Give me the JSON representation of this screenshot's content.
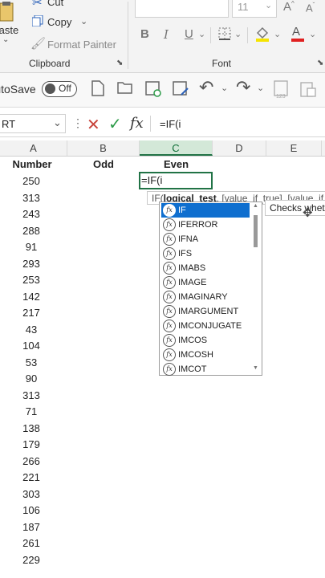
{
  "ribbon": {
    "cut_label": "Cut",
    "copy_label": "Copy",
    "paste_label": "Paste",
    "format_painter_label": "Format Painter",
    "clipboard_group": "Clipboard",
    "font_group": "Font",
    "font_size": "11",
    "bold": "B",
    "italic": "I",
    "underline": "U",
    "font_color_letter": "A"
  },
  "qat": {
    "autosave_label": "AutoSave",
    "toggle_label": "Off"
  },
  "formula_bar": {
    "name_box": "RT",
    "fx_label": "fx",
    "formula": "=IF(i"
  },
  "columns": [
    "A",
    "B",
    "C",
    "D",
    "E"
  ],
  "headers": {
    "number": "Number",
    "odd": "Odd",
    "even": "Even"
  },
  "edit_cell_text": "=IF(i",
  "numbers": [
    "250",
    "313",
    "243",
    "288",
    "91",
    "293",
    "253",
    "142",
    "217",
    "43",
    "104",
    "53",
    "90",
    "313",
    "71",
    "138",
    "179",
    "266",
    "221",
    "303",
    "106",
    "187",
    "261",
    "229"
  ],
  "tooltip": {
    "func": "IF(",
    "arg": "logical_test",
    "rest": ", [value_if_true], [value_if_false])"
  },
  "autocomplete": [
    {
      "name": "IF",
      "selected": true
    },
    {
      "name": "IFERROR"
    },
    {
      "name": "IFNA"
    },
    {
      "name": "IFS"
    },
    {
      "name": "IMABS"
    },
    {
      "name": "IMAGE"
    },
    {
      "name": "IMAGINARY"
    },
    {
      "name": "IMARGUMENT"
    },
    {
      "name": "IMCONJUGATE"
    },
    {
      "name": "IMCOS"
    },
    {
      "name": "IMCOSH"
    },
    {
      "name": "IMCOT"
    }
  ],
  "fx_icon_text": "fx",
  "description": "Checks whether a condition is met",
  "colors": {
    "accent": "#217346",
    "selection": "#0f6fcf"
  }
}
